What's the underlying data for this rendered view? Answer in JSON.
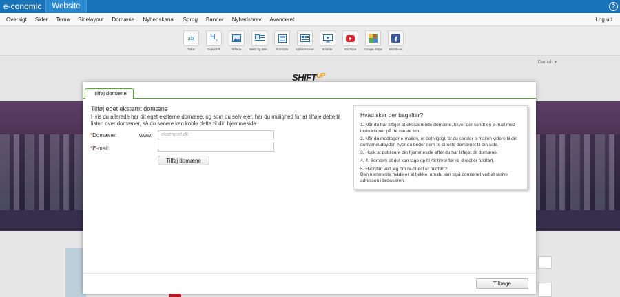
{
  "topbar": {
    "brand": "e-conomic",
    "product_tab": "Website",
    "help_icon": "?"
  },
  "menu": {
    "items": [
      "Oversigt",
      "Sider",
      "Tema",
      "Sidelayout",
      "Domæne",
      "Nyhedskanal",
      "Sprog",
      "Banner",
      "Nyhedsbrev",
      "Avanceret"
    ],
    "logout": "Log ud"
  },
  "toolbar": {
    "tools": [
      {
        "label": "Tekst",
        "icon": "text-icon"
      },
      {
        "label": "Overskrift",
        "icon": "heading-icon"
      },
      {
        "label": "Billede",
        "icon": "image-icon"
      },
      {
        "label": "Tekst og bille...",
        "icon": "text-image-icon"
      },
      {
        "label": "Formular",
        "icon": "form-icon"
      },
      {
        "label": "Nyhedskanal",
        "icon": "news-icon"
      },
      {
        "label": "Banner",
        "icon": "banner-icon"
      },
      {
        "label": "YouTube",
        "icon": "youtube-icon"
      },
      {
        "label": "Google Maps",
        "icon": "google-maps-icon"
      },
      {
        "label": "Facebook",
        "icon": "facebook-icon"
      }
    ]
  },
  "page": {
    "language": "Danish",
    "logo_main": "SHIFT",
    "logo_accent": "UP"
  },
  "modal": {
    "tab": "Tilføj domæne",
    "form": {
      "title": "Tilføj eget eksternt domæne",
      "description": "Hvis du allerede har dit eget eksterne domæne, og som du selv ejer, har du mulighed for at tilføje dette til listen over domæner, så du senere kan koble dette til din hjemmeside.",
      "required_mark": "*",
      "domain_label": "Domæne:",
      "domain_prefix": "www.",
      "domain_placeholder": "eksempel.dk",
      "domain_value": "",
      "email_label": "E-mail:",
      "email_value": "",
      "submit": "Tilføj domæne"
    },
    "info": {
      "title": "Hvad sker der bagefter?",
      "items": [
        "1. Når du har tilføjet et eksisterende domæne, bliver der sendt en e-mail med instruktioner på de næste trin.",
        "2. Når du modtager e-mailen, er det vigtigt, at du sender e-mailen videre til din domæneudbyder, hvor du beder dem re-directe domænet til din side.",
        "3. Husk at publicere din hjemmeside efter du har tilføjet dit domæne.",
        "4. 4. Bemærk at det kan tage op til 48 timer før re-direct er fuldført.",
        "5. Hvordan ved jeg om re-direct er fuldført?\nDen nemmeste måde er at tjekke, om du kan tilgå domænet ved at skrive adressen i browseren."
      ]
    },
    "back": "Tilbage"
  },
  "colors": {
    "topbar": "#1a73b8",
    "accent_green": "#5aaa2a",
    "required": "#c0392b"
  }
}
